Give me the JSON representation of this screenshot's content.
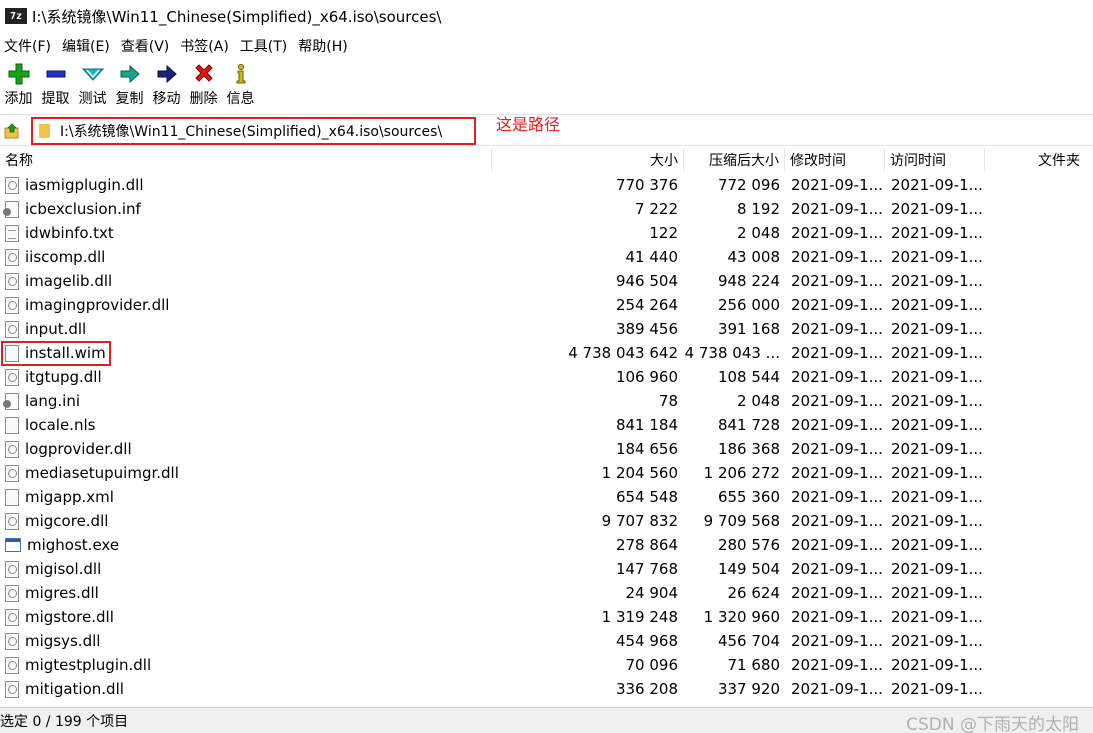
{
  "window": {
    "app_icon_text": "7z",
    "title": "I:\\系统镜像\\Win11_Chinese(Simplified)_x64.iso\\sources\\"
  },
  "menu": [
    "文件(F)",
    "编辑(E)",
    "查看(V)",
    "书签(A)",
    "工具(T)",
    "帮助(H)"
  ],
  "toolbar": [
    {
      "label": "添加",
      "icon": "add-icon",
      "color": "#1aa31a"
    },
    {
      "label": "提取",
      "icon": "extract-icon",
      "color": "#1f33c7"
    },
    {
      "label": "测试",
      "icon": "test-icon",
      "color": "#1fb3b3"
    },
    {
      "label": "复制",
      "icon": "copy-icon",
      "color": "#19a58a"
    },
    {
      "label": "移动",
      "icon": "move-icon",
      "color": "#1a237e"
    },
    {
      "label": "删除",
      "icon": "delete-icon",
      "color": "#e01414"
    },
    {
      "label": "信息",
      "icon": "info-icon",
      "color": "#d4b800"
    }
  ],
  "address": {
    "path": "I:\\系统镜像\\Win11_Chinese(Simplified)_x64.iso\\sources\\",
    "annotation": "这是路径"
  },
  "columns": {
    "name": "名称",
    "size": "大小",
    "packed_size": "压缩后大小",
    "modified": "修改时间",
    "accessed": "访问时间",
    "folders": "文件夹"
  },
  "files": [
    {
      "name": "iasmigplugin.dll",
      "type": "dll",
      "size": "770 376",
      "packed": "772 096",
      "modified": "2021-09-1...",
      "accessed": "2021-09-1..."
    },
    {
      "name": "icbexclusion.inf",
      "type": "inf",
      "size": "7 222",
      "packed": "8 192",
      "modified": "2021-09-1...",
      "accessed": "2021-09-1..."
    },
    {
      "name": "idwbinfo.txt",
      "type": "txt",
      "size": "122",
      "packed": "2 048",
      "modified": "2021-09-1...",
      "accessed": "2021-09-1..."
    },
    {
      "name": "iiscomp.dll",
      "type": "dll",
      "size": "41 440",
      "packed": "43 008",
      "modified": "2021-09-1...",
      "accessed": "2021-09-1..."
    },
    {
      "name": "imagelib.dll",
      "type": "dll",
      "size": "946 504",
      "packed": "948 224",
      "modified": "2021-09-1...",
      "accessed": "2021-09-1..."
    },
    {
      "name": "imagingprovider.dll",
      "type": "dll",
      "size": "254 264",
      "packed": "256 000",
      "modified": "2021-09-1...",
      "accessed": "2021-09-1..."
    },
    {
      "name": "input.dll",
      "type": "dll",
      "size": "389 456",
      "packed": "391 168",
      "modified": "2021-09-1...",
      "accessed": "2021-09-1..."
    },
    {
      "name": "install.wim",
      "type": "blank",
      "size": "4 738 043 642",
      "packed": "4 738 043 ...",
      "modified": "2021-09-1...",
      "accessed": "2021-09-1..."
    },
    {
      "name": "itgtupg.dll",
      "type": "dll",
      "size": "106 960",
      "packed": "108 544",
      "modified": "2021-09-1...",
      "accessed": "2021-09-1..."
    },
    {
      "name": "lang.ini",
      "type": "inf",
      "size": "78",
      "packed": "2 048",
      "modified": "2021-09-1...",
      "accessed": "2021-09-1..."
    },
    {
      "name": "locale.nls",
      "type": "blank",
      "size": "841 184",
      "packed": "841 728",
      "modified": "2021-09-1...",
      "accessed": "2021-09-1..."
    },
    {
      "name": "logprovider.dll",
      "type": "dll",
      "size": "184 656",
      "packed": "186 368",
      "modified": "2021-09-1...",
      "accessed": "2021-09-1..."
    },
    {
      "name": "mediasetupuimgr.dll",
      "type": "dll",
      "size": "1 204 560",
      "packed": "1 206 272",
      "modified": "2021-09-1...",
      "accessed": "2021-09-1..."
    },
    {
      "name": "migapp.xml",
      "type": "blank",
      "size": "654 548",
      "packed": "655 360",
      "modified": "2021-09-1...",
      "accessed": "2021-09-1..."
    },
    {
      "name": "migcore.dll",
      "type": "dll",
      "size": "9 707 832",
      "packed": "9 709 568",
      "modified": "2021-09-1...",
      "accessed": "2021-09-1..."
    },
    {
      "name": "mighost.exe",
      "type": "exe",
      "size": "278 864",
      "packed": "280 576",
      "modified": "2021-09-1...",
      "accessed": "2021-09-1..."
    },
    {
      "name": "migisol.dll",
      "type": "dll",
      "size": "147 768",
      "packed": "149 504",
      "modified": "2021-09-1...",
      "accessed": "2021-09-1..."
    },
    {
      "name": "migres.dll",
      "type": "dll",
      "size": "24 904",
      "packed": "26 624",
      "modified": "2021-09-1...",
      "accessed": "2021-09-1..."
    },
    {
      "name": "migstore.dll",
      "type": "dll",
      "size": "1 319 248",
      "packed": "1 320 960",
      "modified": "2021-09-1...",
      "accessed": "2021-09-1..."
    },
    {
      "name": "migsys.dll",
      "type": "dll",
      "size": "454 968",
      "packed": "456 704",
      "modified": "2021-09-1...",
      "accessed": "2021-09-1..."
    },
    {
      "name": "migtestplugin.dll",
      "type": "dll",
      "size": "70 096",
      "packed": "71 680",
      "modified": "2021-09-1...",
      "accessed": "2021-09-1..."
    },
    {
      "name": "mitigation.dll",
      "type": "dll",
      "size": "336 208",
      "packed": "337 920",
      "modified": "2021-09-1...",
      "accessed": "2021-09-1..."
    }
  ],
  "status": "选定 0 / 199 个项目",
  "watermark": "CSDN @下雨天的太阳"
}
